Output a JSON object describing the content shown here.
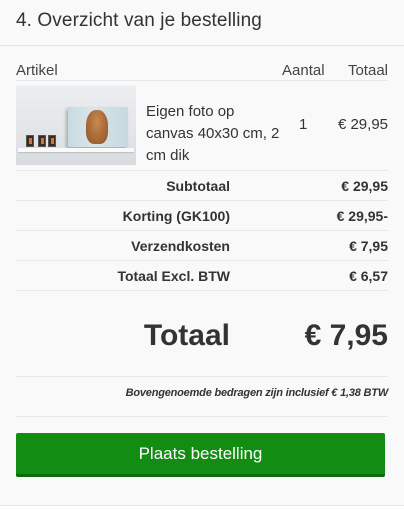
{
  "section": {
    "title": "4. Overzicht van je bestelling"
  },
  "table": {
    "headers": {
      "article": "Artikel",
      "quantity": "Aantal",
      "total": "Totaal"
    },
    "items": [
      {
        "name": "Eigen foto op canvas 40x30 cm, 2 cm dik",
        "quantity": "1",
        "total": "€ 29,95"
      }
    ]
  },
  "summary": {
    "rows": [
      {
        "label": "Subtotaal",
        "value": "€ 29,95"
      },
      {
        "label": "Korting (GK100)",
        "value": "€ 29,95-"
      },
      {
        "label": "Verzendkosten",
        "value": "€ 7,95"
      },
      {
        "label": "Totaal Excl. BTW",
        "value": "€ 6,57"
      }
    ],
    "total_label": "Totaal",
    "total_value": "€ 7,95",
    "vat_note": "Bovengenoemde bedragen zijn inclusief € 1,38 BTW"
  },
  "actions": {
    "place_order_label": "Plaats bestelling",
    "button_color": "#128c12"
  }
}
